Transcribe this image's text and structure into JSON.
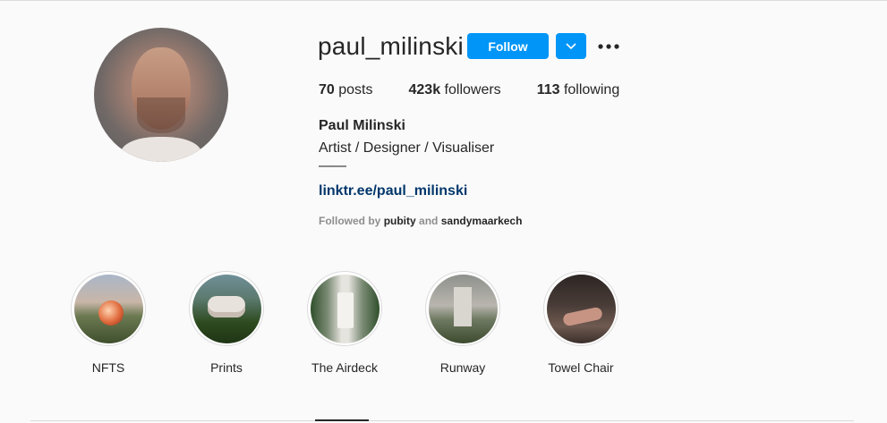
{
  "profile": {
    "username": "paul_milinski",
    "follow_label": "Follow",
    "posts_count": "70",
    "posts_label": "posts",
    "followers_count": "423k",
    "followers_label": "followers",
    "following_count": "113",
    "following_label": "following",
    "full_name": "Paul Milinski",
    "bio": "Artist / Designer / Visualiser",
    "bio_rule": "——",
    "link": "linktr.ee/paul_milinski",
    "followed_by_prefix": "Followed by",
    "followed_by_1": "pubity",
    "followed_by_and": "and",
    "followed_by_2": "sandymaarkech"
  },
  "highlights": [
    {
      "label": "NFTS"
    },
    {
      "label": "Prints"
    },
    {
      "label": "The Airdeck"
    },
    {
      "label": "Runway"
    },
    {
      "label": "Towel Chair"
    }
  ],
  "icons": {
    "dropdown": "chevron-down-icon",
    "more": "more-options-icon"
  },
  "colors": {
    "accent": "#0095f6",
    "link": "#00376b",
    "text": "#262626",
    "muted": "#8e8e8e",
    "background": "#fafafa"
  }
}
